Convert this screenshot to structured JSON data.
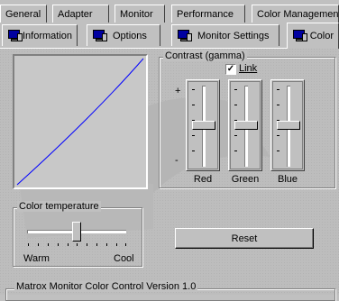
{
  "tabs_row1": [
    "General",
    "Adapter",
    "Monitor",
    "Performance",
    "Color Management"
  ],
  "tabs_row2": [
    {
      "label": "Information",
      "icon": "monitor-icon"
    },
    {
      "label": "Options",
      "icon": "monitor-icon"
    },
    {
      "label": "Monitor Settings",
      "icon": "monitor-icon"
    },
    {
      "label": "Color",
      "icon": "monitor-icon"
    }
  ],
  "active_tab": "Color",
  "contrast": {
    "title": "Contrast (gamma)",
    "link_label": "Link",
    "link_checked": true,
    "plus_label": "+",
    "minus_label": "-",
    "sliders": [
      {
        "label": "Red",
        "level": 0.5
      },
      {
        "label": "Green",
        "level": 0.5
      },
      {
        "label": "Blue",
        "level": 0.5
      }
    ]
  },
  "color_temperature": {
    "title": "Color temperature",
    "min_label": "Warm",
    "max_label": "Cool",
    "level": 0.5
  },
  "reset_button": "Reset",
  "version_text": "Matrox Monitor Color Control Version 1.0",
  "colors": {
    "face": "#c0c0c0",
    "curve": "#0000ff",
    "icon_screen": "#0000a0"
  }
}
